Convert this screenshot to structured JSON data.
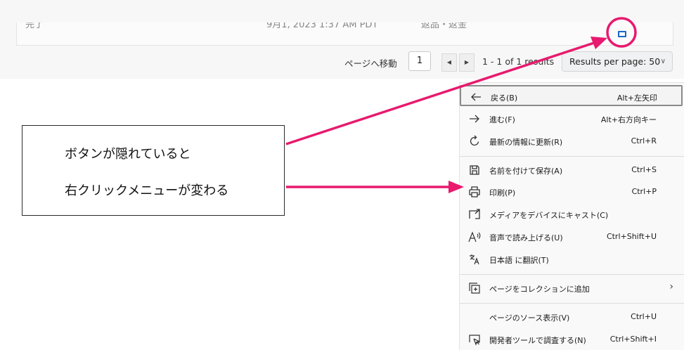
{
  "background": {
    "row": {
      "col1": "完了",
      "col2": "9月1, 2023 1:37 AM PDT",
      "col3": "返品・返金"
    },
    "pager": {
      "goto_label": "ページへ移動",
      "page_value": "1",
      "prev": "◀",
      "next": "▶",
      "results_text": "1 - 1 of 1 results",
      "per_page_label": "Results per page: 50",
      "per_page_chevron": "∨"
    }
  },
  "context_menu": {
    "items": [
      {
        "icon": "back-arrow-icon",
        "label": "戻る(B)",
        "shortcut": "Alt+左矢印"
      },
      {
        "icon": "forward-arrow-icon",
        "label": "進む(F)",
        "shortcut": "Alt+右方向キー"
      },
      {
        "icon": "refresh-icon",
        "label": "最新の情報に更新(R)",
        "shortcut": "Ctrl+R"
      },
      {
        "icon": "save-icon",
        "label": "名前を付けて保存(A)",
        "shortcut": "Ctrl+S"
      },
      {
        "icon": "print-icon",
        "label": "印刷(P)",
        "shortcut": "Ctrl+P"
      },
      {
        "icon": "cast-icon",
        "label": "メディアをデバイスにキャスト(C)",
        "shortcut": ""
      },
      {
        "icon": "read-aloud-icon",
        "label": "音声で読み上げる(U)",
        "shortcut": "Ctrl+Shift+U"
      },
      {
        "icon": "translate-icon",
        "label": "日本語 に翻訳(T)",
        "shortcut": ""
      },
      {
        "icon": "collection-add-icon",
        "label": "ページをコレクションに追加",
        "shortcut": "",
        "submenu": "›"
      },
      {
        "icon": "",
        "label": "ページのソース表示(V)",
        "shortcut": "Ctrl+U"
      },
      {
        "icon": "devtools-icon",
        "label": "開発者ツールで調査する(N)",
        "shortcut": "Ctrl+Shift+I"
      }
    ]
  },
  "annotation": {
    "line1": "ボタンが隠れていると",
    "line2": "右クリックメニューが変わる",
    "accent_color": "#e8196e"
  }
}
